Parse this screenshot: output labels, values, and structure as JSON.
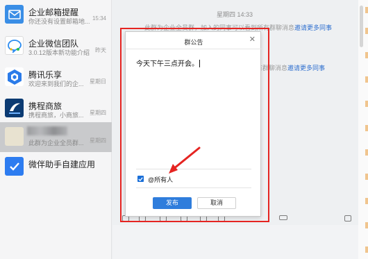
{
  "sidebar": {
    "conversations": [
      {
        "name": "企业邮箱提醒",
        "preview": "你还没有设置邮箱地...",
        "time": "15:34"
      },
      {
        "name": "企业微信团队",
        "preview": "3.0.12版本新功能介绍",
        "time": "昨天"
      },
      {
        "name": "腾讯乐享",
        "preview": "欢迎来到我们的企...",
        "time": "星期日"
      },
      {
        "name": "携程商旅",
        "preview": "携程商旅，小商旅...",
        "time": "星期四"
      },
      {
        "name": "",
        "preview": "此群为企业全员群...",
        "time": "星期四"
      },
      {
        "name": "微伴助手自建应用",
        "preview": "",
        "time": ""
      }
    ]
  },
  "chat": {
    "timestamp": "星期四 14:33",
    "system_message_1": "此群为企业全员群，加入的同事可以看到所有群聊消息",
    "invite_link_1": "邀请更多同事",
    "system_message_2": "查看所有群聊消息",
    "invite_link_2": "邀请更多同事"
  },
  "dialog": {
    "title": "群公告",
    "close_icon": "close-icon",
    "content": "今天下午三点开会。",
    "mention_all_label": "@所有人",
    "mention_all_checked": true,
    "publish_label": "发布",
    "cancel_label": "取消"
  },
  "colors": {
    "accent": "#2f7ddc",
    "annotation": "#e52421",
    "active_row": "#c9cacc"
  }
}
